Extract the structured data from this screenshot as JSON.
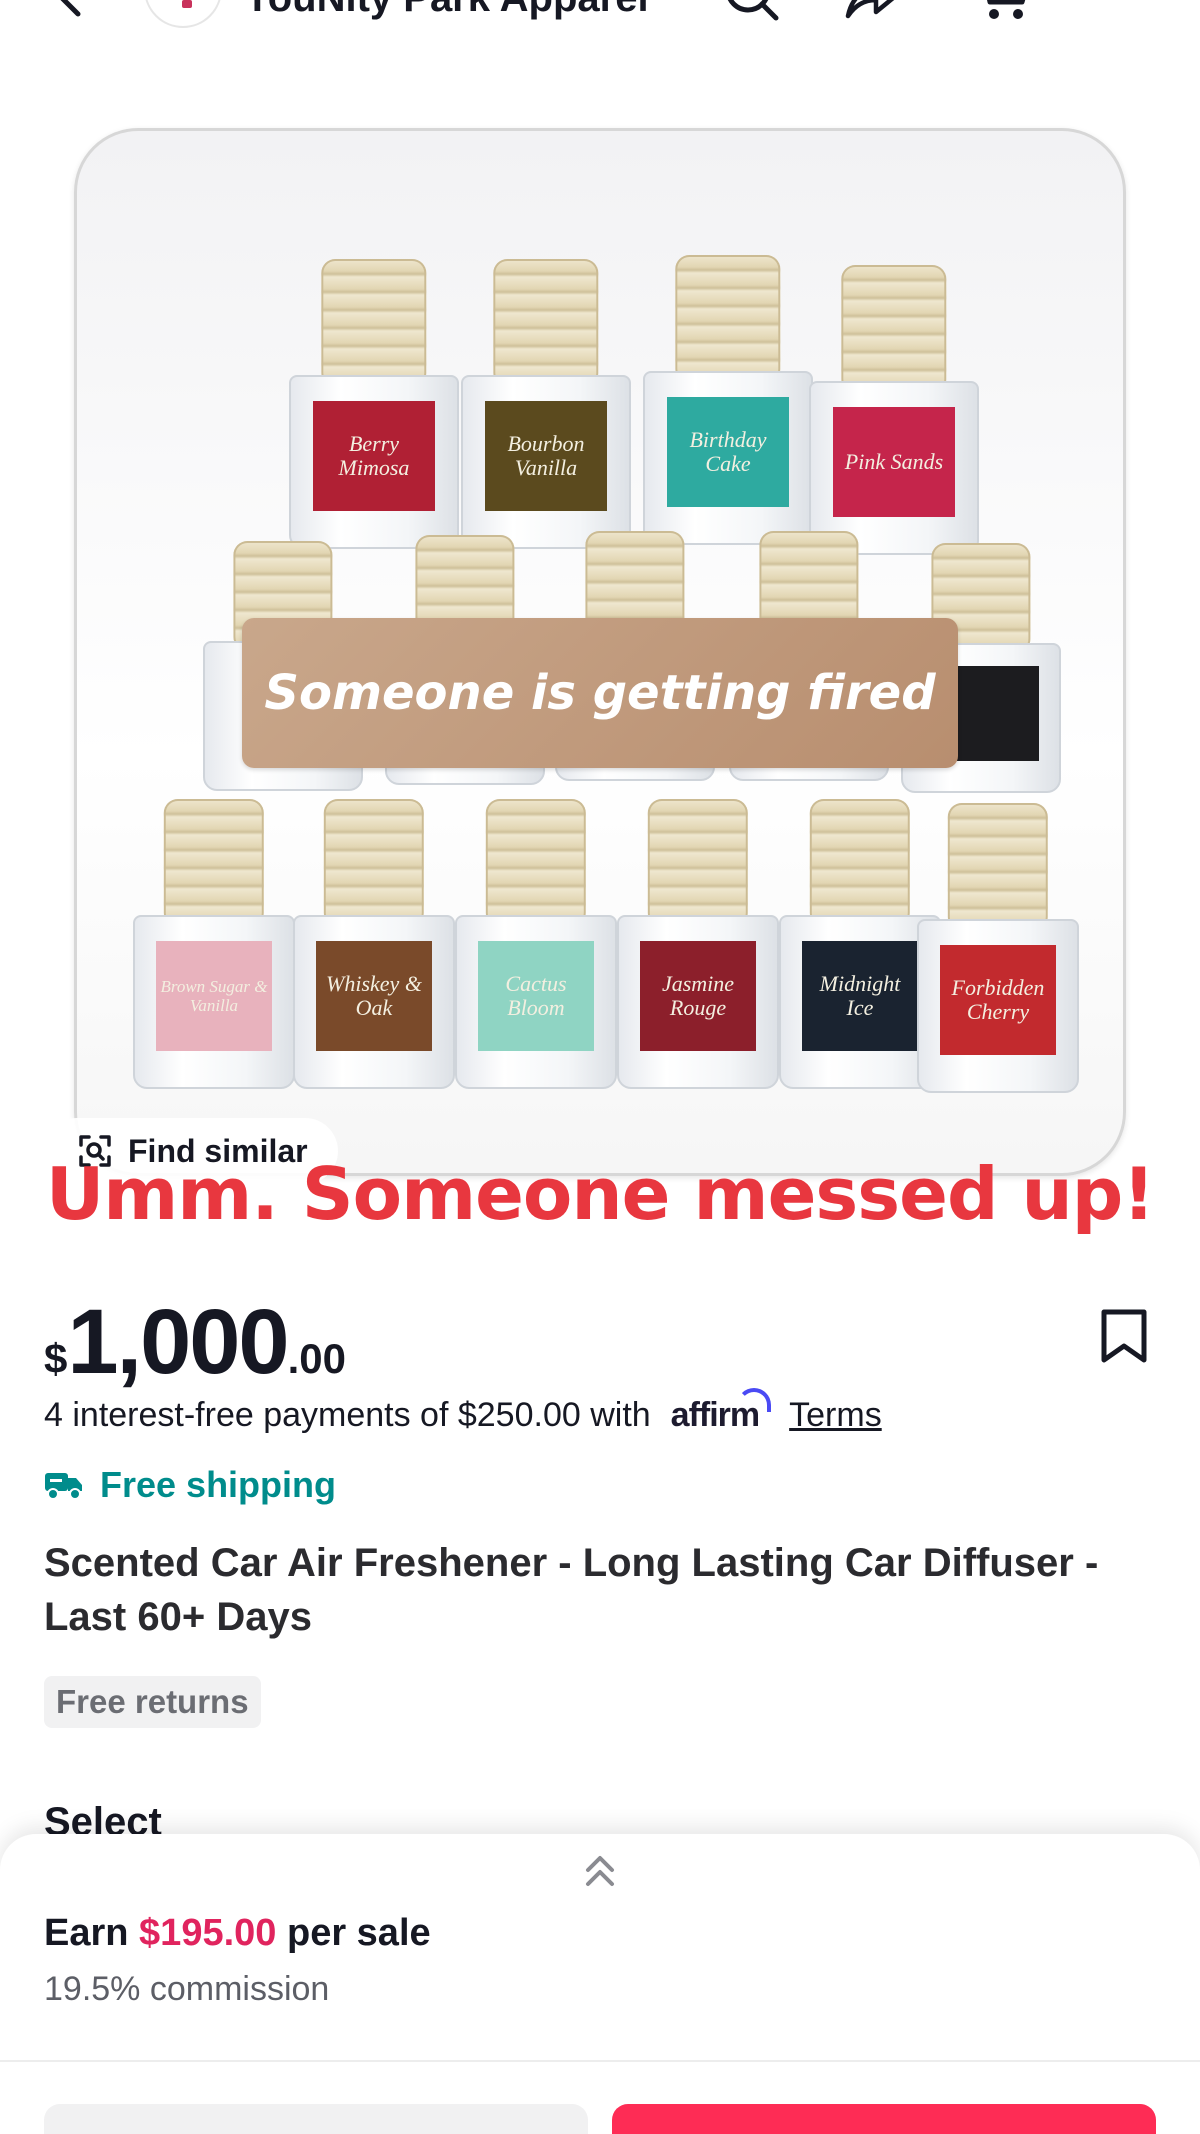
{
  "header": {
    "shop_name": "YouNity Park Apparel",
    "icons": [
      "back-arrow-icon",
      "search-icon",
      "share-icon",
      "cart-icon"
    ]
  },
  "product_image": {
    "overlay_text": "Someone is getting fired",
    "bottle_labels": {
      "top": [
        "Berry Mimosa",
        "Bourbon Vanilla",
        "Birthday Cake",
        "Pink Sands"
      ],
      "bottom": [
        "Brown Sugar & Vanilla",
        "Whiskey & Oak",
        "Cactus Bloom",
        "Jasmine Rouge",
        "Midnight Ice",
        "Forbidden Cherry"
      ]
    },
    "find_similar_label": "Find similar"
  },
  "caption": "Umm. Someone messed up!",
  "price": {
    "currency": "$",
    "whole": "1,000",
    "cents": ".00"
  },
  "payments": {
    "text": "4 interest-free payments of $250.00 with",
    "provider": "affirm",
    "terms_label": "Terms"
  },
  "shipping": {
    "label": "Free shipping",
    "color": "#008c8c"
  },
  "product": {
    "title": "Scented Car Air Freshener - Long Lasting Car Diffuser - Last 60+ Days",
    "returns_badge": "Free returns"
  },
  "select_label": "Select",
  "sheet": {
    "earn_prefix": "Earn",
    "earn_amount": "$195.00",
    "earn_suffix": "per sale",
    "commission": "19.5% commission"
  },
  "colors": {
    "accent_red": "#e8373f",
    "earn_pink": "#e0245e",
    "primary_button": "#fe2c55"
  }
}
